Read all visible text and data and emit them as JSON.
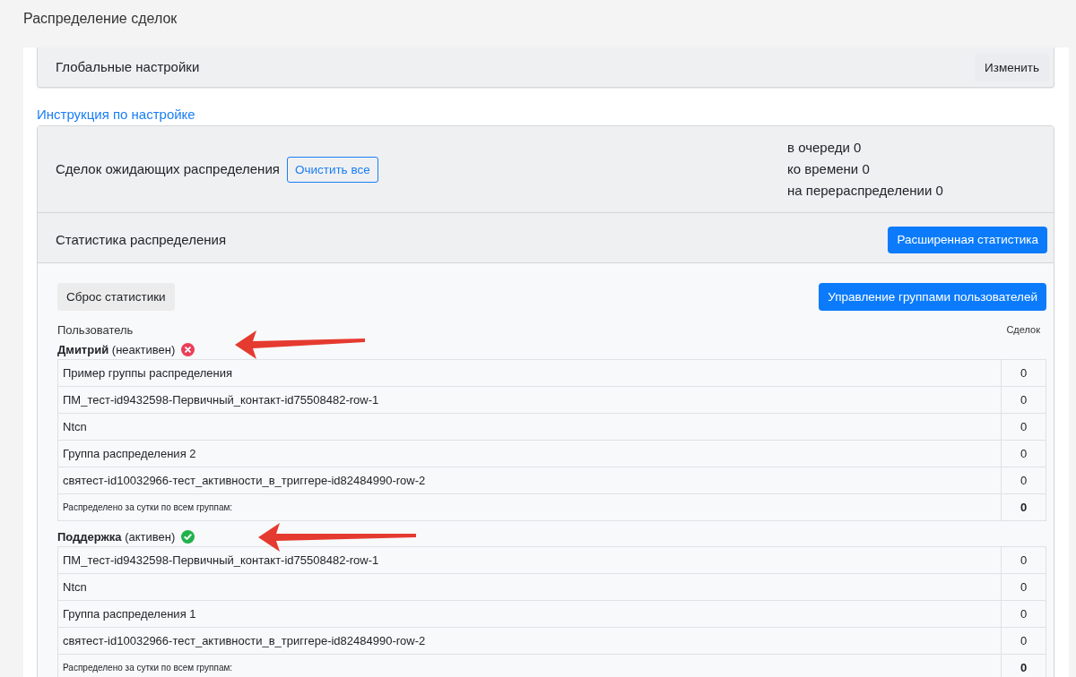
{
  "page": {
    "title": "Распределение сделок"
  },
  "global_settings": {
    "title": "Глобальные настройки",
    "edit_button": "Изменить"
  },
  "instructions_link": "Инструкция по настройке",
  "pending": {
    "label": "Сделок ожидающих распределения",
    "clear_button": "Очистить все",
    "counters": [
      "в очереди 0",
      "ко времени 0",
      "на перераспределении 0"
    ]
  },
  "statistics": {
    "title": "Статистика распределения",
    "extended_button": "Расширенная статистика",
    "reset_button": "Сброс статистики",
    "manage_groups_button": "Управление группами пользователей",
    "columns": [
      "Пользователь",
      "Сделок"
    ],
    "users": [
      {
        "name": "Дмитрий",
        "status": "(неактивен)",
        "active": false,
        "annotated": true,
        "rows": [
          {
            "group": "Пример группы распределения",
            "deals": "0"
          },
          {
            "group": "ПМ_тест-id9432598-Первичный_контакт-id75508482-row-1",
            "deals": "0"
          },
          {
            "group": "Ntcn",
            "deals": "0"
          },
          {
            "group": "Группа распределения 2",
            "deals": "0"
          },
          {
            "group": "святест-id10032966-тест_активности_в_триггере-id82484990-row-2",
            "deals": "0"
          }
        ],
        "total": {
          "label": "Распределено за сутки по всем группам:",
          "deals": "0"
        }
      },
      {
        "name": "Поддержка",
        "status": "(активен)",
        "active": true,
        "annotated": true,
        "rows": [
          {
            "group": "ПМ_тест-id9432598-Первичный_контакт-id75508482-row-1",
            "deals": "0"
          },
          {
            "group": "Ntcn",
            "deals": "0"
          },
          {
            "group": "Группа распределения 1",
            "deals": "0"
          },
          {
            "group": "святест-id10032966-тест_активности_в_триггере-id82484990-row-2",
            "deals": "0"
          }
        ],
        "total": {
          "label": "Распределено за сутки по всем группам:",
          "deals": "0"
        }
      }
    ]
  }
}
